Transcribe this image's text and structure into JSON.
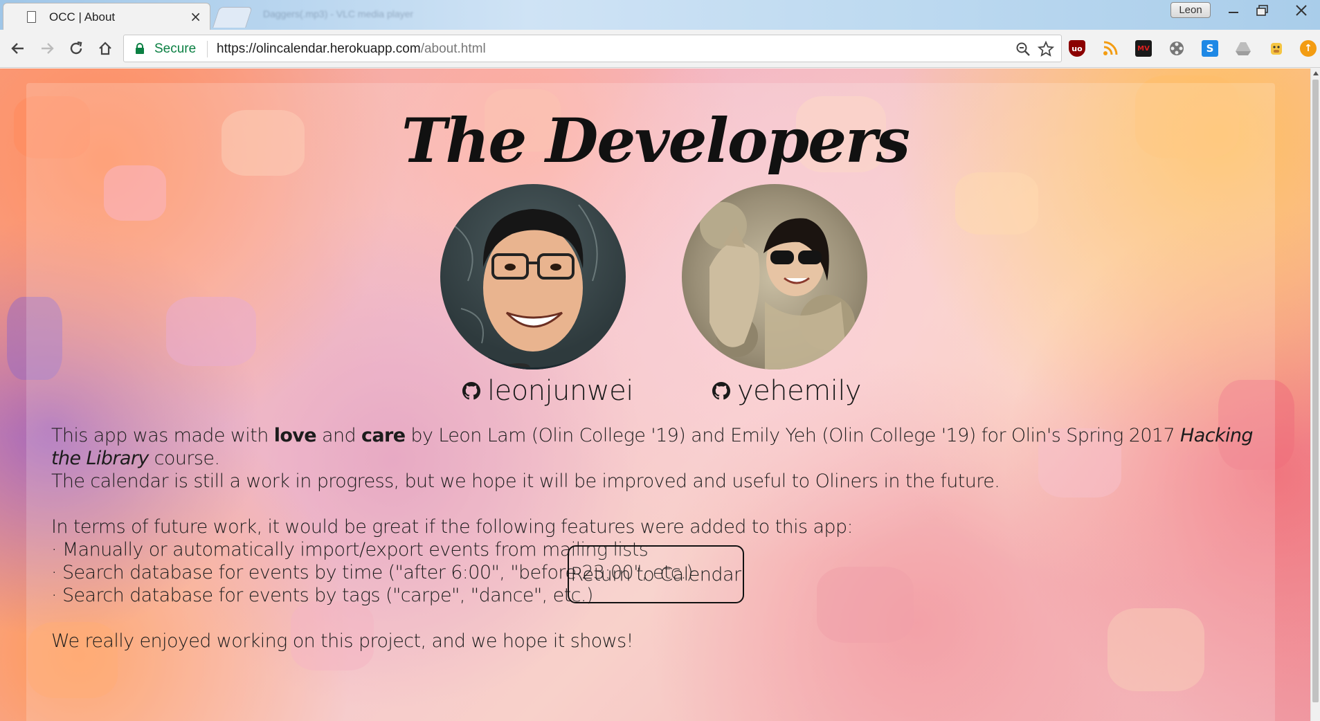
{
  "browser": {
    "tab_title": "OCC | About",
    "tab_close": "×",
    "background_tab_text": "Daggers(.mp3) - VLC media player",
    "user_name": "Leon",
    "secure_label": "Secure",
    "url_host": "https://olincalendar.herokuapp.com",
    "url_path": "/about.html",
    "extensions": [
      "ublock-icon",
      "rss-icon",
      "mv-icon",
      "film-icon",
      "s-icon",
      "drive-icon",
      "cow-icon",
      "orange-icon"
    ],
    "ext_labels": {
      "ublock": "uo",
      "mv": "MV",
      "s": "S",
      "orange": "↑"
    }
  },
  "page": {
    "title": "The Developers",
    "developers": [
      {
        "handle": "leonjunwei"
      },
      {
        "handle": "yehemily"
      }
    ],
    "intro": {
      "p1_a": "This app was made with ",
      "love": "love",
      "p1_b": " and ",
      "care": "care",
      "p1_c": " by Leon Lam (Olin College '19) and Emily Yeh (Olin College '19) for Olin's Spring 2017 ",
      "course": "Hacking the Library",
      "p1_d": " course.",
      "p2": "The calendar is still a work in progress, but we hope it will be improved and useful to Oliners in the future."
    },
    "future_intro": "In terms of future work, it would be great if the following features were added to this app:",
    "future_items": [
      "· Manually or automatically import/export events from mailing lists",
      "· Search database for events by time (\"after 6:00\", \"before 23:00\", etc.)",
      "· Search database for events by tags (\"carpe\", \"dance\", etc.)"
    ],
    "closing": "We really enjoyed working on this project, and we hope it shows!",
    "return_label": "Return to Calendar"
  },
  "colors": {
    "secure_green": "#0b8043",
    "text": "#1c1c1c"
  }
}
